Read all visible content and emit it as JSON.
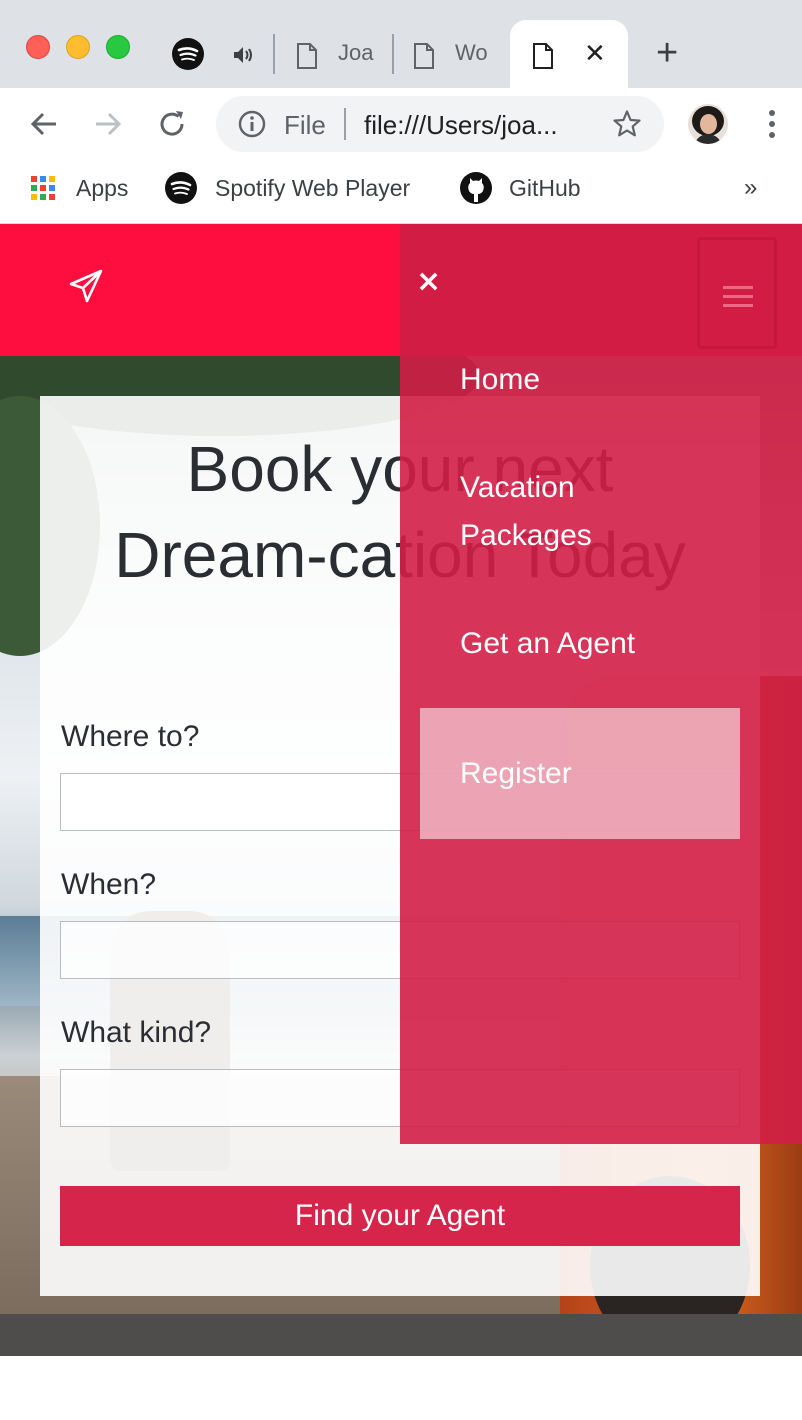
{
  "browser": {
    "tabs": [
      {
        "label": ""
      },
      {
        "label": "Joa"
      },
      {
        "label": "Wo"
      },
      {
        "label": ""
      }
    ],
    "close_tab_glyph": "✕",
    "new_tab_glyph": "+",
    "omnibox": {
      "scheme": "File",
      "url": "file:///Users/joa..."
    },
    "bookmarks": [
      {
        "label": "Apps",
        "icon": "apps-grid-icon"
      },
      {
        "label": "Spotify Web Player",
        "icon": "spotify-icon"
      },
      {
        "label": "GitHub",
        "icon": "github-icon"
      }
    ],
    "bookmarks_overflow": "»",
    "colors": {
      "tabstrip": "#dee1e6",
      "toolbar": "#ffffff"
    }
  },
  "site": {
    "header_color": "#fe0e3e",
    "logo_icon": "paper-plane-icon",
    "hero": {
      "headline_line1": "Book your next",
      "headline_line2": "Dream-cation Today"
    },
    "form": {
      "fields": [
        {
          "label": "Where to?",
          "value": ""
        },
        {
          "label": "When?",
          "value": ""
        },
        {
          "label": "What kind?",
          "value": ""
        }
      ],
      "submit_label": "Find your Agent"
    },
    "menu": {
      "close_glyph": "×",
      "items": [
        "Home",
        "Vacation",
        "Packages",
        "Get an Agent"
      ],
      "register_label": "Register",
      "panel_color": "#d31c43"
    }
  }
}
